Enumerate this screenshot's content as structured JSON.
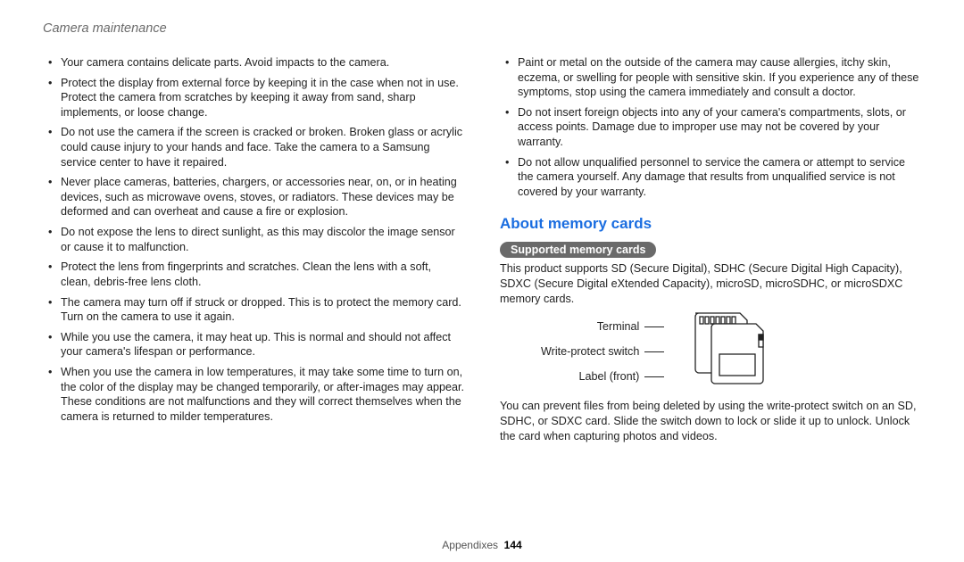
{
  "header": {
    "title": "Camera maintenance"
  },
  "left": {
    "bullets": [
      "Your camera contains delicate parts. Avoid impacts to the camera.",
      "Protect the display from external force by keeping it in the case when not in use. Protect the camera from scratches by keeping it away from sand, sharp implements, or loose change.",
      "Do not use the camera if the screen is cracked or broken. Broken glass or acrylic could cause injury to your hands and face. Take the camera to a Samsung service center to have it repaired.",
      "Never place cameras, batteries, chargers, or accessories near, on, or in heating devices, such as microwave ovens, stoves, or radiators. These devices may be deformed and can overheat and cause a fire or explosion.",
      "Do not expose the lens to direct sunlight, as this may discolor the image sensor or cause it to malfunction.",
      "Protect the lens from fingerprints and scratches. Clean the lens with a soft, clean, debris-free lens cloth.",
      "The camera may turn off if struck or dropped. This is to protect the memory card. Turn on the camera to use it again.",
      "While you use the camera, it may heat up. This is normal and should not affect your camera's lifespan or performance.",
      "When you use the camera in low temperatures, it may take some time to turn on, the color of the display may be changed temporarily, or after-images may appear. These conditions are not malfunctions and they will correct themselves when the camera is returned to milder temperatures."
    ]
  },
  "right": {
    "top_bullets": [
      "Paint or metal on the outside of the camera may cause allergies, itchy skin, eczema, or swelling for people with sensitive skin. If you experience any of these symptoms, stop using the camera immediately and consult a doctor.",
      "Do not insert foreign objects into any of your camera's compartments, slots, or access points. Damage due to improper use may not be covered by your warranty.",
      "Do not allow unqualified personnel to service the camera or attempt to service the camera yourself. Any damage that results from unqualified service is not covered by your warranty."
    ],
    "section_title": "About memory cards",
    "pill": "Supported memory cards",
    "support_text": "This product supports SD (Secure Digital), SDHC (Secure Digital High Capacity), SDXC (Secure Digital eXtended Capacity), microSD, microSDHC, or microSDXC memory cards.",
    "diagram": {
      "labels": {
        "terminal": "Terminal",
        "write_protect": "Write-protect switch",
        "label": "Label (front)"
      }
    },
    "write_protect_text": "You can prevent files from being deleted by using the write-protect switch on an SD, SDHC, or SDXC card. Slide the switch down to lock or slide it up to unlock. Unlock the card when capturing photos and videos."
  },
  "footer": {
    "section": "Appendixes",
    "page": "144"
  }
}
